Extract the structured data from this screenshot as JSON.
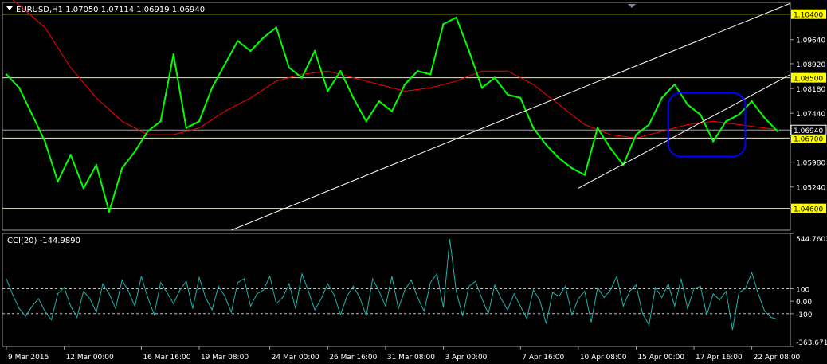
{
  "header": {
    "symbol_line": "EURUSD,H1  1.07050 1.07114 1.06919 1.06940",
    "indicator_line": "CCI(20) -144.9890"
  },
  "colors": {
    "background": "#000000",
    "price_line": "#00ff00",
    "moving_average": "#ff0000",
    "level_line": "#ffff00",
    "channel_line": "#ffffff",
    "current_price": "#a0a0a0",
    "highlight_box": "#0000ff",
    "cci_line": "#20b2aa",
    "axis_text": "#ffffff"
  },
  "chart_data": [
    {
      "type": "line",
      "symbol": "EURUSD",
      "timeframe": "H1",
      "ohlc_readout": {
        "open": 1.0705,
        "high": 1.07114,
        "low": 1.06919,
        "close": 1.0694
      },
      "ylim": [
        1.0395,
        1.1075
      ],
      "y_tick_labels": [
        "1.09640",
        "1.08920",
        "1.08180",
        "1.07440",
        "1.05980",
        "1.05240"
      ],
      "y_ticks": [
        1.0964,
        1.0892,
        1.0818,
        1.0744,
        1.0598,
        1.0524
      ],
      "x_tick_labels": [
        "9 Mar 2015",
        "12 Mar 00:00",
        "16 Mar 16:00",
        "19 Mar 08:00",
        "24 Mar 00:00",
        "26 Mar 16:00",
        "31 Mar 08:00",
        "3 Apr 00:00",
        "7 Apr 16:00",
        "10 Apr 08:00",
        "15 Apr 00:00",
        "17 Apr 16:00",
        "22 Apr 08:00"
      ],
      "x_ticks": [
        0,
        9,
        21,
        30,
        41,
        50,
        59,
        68,
        80,
        89,
        98,
        107,
        116
      ],
      "series": [
        {
          "role": "price",
          "x": [
            0,
            2,
            4,
            6,
            8,
            10,
            12,
            14,
            16,
            18,
            20,
            22,
            24,
            26,
            28,
            30,
            32,
            34,
            36,
            38,
            40,
            42,
            44,
            46,
            48,
            50,
            52,
            54,
            56,
            58,
            60,
            62,
            64,
            66,
            68,
            70,
            72,
            74,
            76,
            78,
            80,
            82,
            84,
            86,
            88,
            90,
            92,
            94,
            96,
            98,
            100,
            102,
            104,
            106,
            108,
            110,
            112,
            114,
            116,
            118,
            120
          ],
          "values": [
            1.086,
            1.082,
            1.074,
            1.066,
            1.054,
            1.062,
            1.052,
            1.059,
            1.045,
            1.058,
            1.063,
            1.069,
            1.072,
            1.092,
            1.07,
            1.072,
            1.082,
            1.089,
            1.096,
            1.093,
            1.097,
            1.1,
            1.088,
            1.085,
            1.093,
            1.081,
            1.087,
            1.079,
            1.072,
            1.078,
            1.075,
            1.083,
            1.087,
            1.086,
            1.101,
            1.103,
            1.093,
            1.082,
            1.085,
            1.08,
            1.079,
            1.07,
            1.065,
            1.061,
            1.058,
            1.056,
            1.07,
            1.064,
            1.059,
            1.068,
            1.071,
            1.079,
            1.083,
            1.077,
            1.074,
            1.066,
            1.072,
            1.074,
            1.078,
            1.073,
            1.069
          ]
        },
        {
          "role": "moving-average",
          "x": [
            0,
            6,
            10,
            14,
            18,
            22,
            26,
            30,
            34,
            38,
            42,
            46,
            50,
            54,
            58,
            62,
            66,
            70,
            74,
            78,
            82,
            86,
            90,
            94,
            98,
            102,
            106,
            110,
            114,
            118,
            120
          ],
          "values": [
            1.11,
            1.1,
            1.088,
            1.079,
            1.072,
            1.068,
            1.068,
            1.07,
            1.075,
            1.079,
            1.084,
            1.086,
            1.087,
            1.085,
            1.083,
            1.081,
            1.082,
            1.084,
            1.087,
            1.087,
            1.083,
            1.077,
            1.071,
            1.068,
            1.067,
            1.069,
            1.071,
            1.072,
            1.071,
            1.07,
            1.0695
          ]
        }
      ],
      "levels": [
        {
          "label": "1.10400",
          "value": 1.104
        },
        {
          "label": "1.08500",
          "value": 1.085
        },
        {
          "label": "1.06700",
          "value": 1.067
        },
        {
          "label": "1.04600",
          "value": 1.046
        }
      ],
      "current_price": {
        "label": "1.06940",
        "value": 1.0694
      },
      "channel": {
        "upper": [
          [
            35,
            1.0395
          ],
          [
            123,
            1.108
          ]
        ],
        "lower": [
          [
            89,
            1.052
          ],
          [
            123,
            1.087
          ]
        ]
      },
      "highlight": {
        "x": [
          103,
          115
        ],
        "y": [
          1.0615,
          1.0805
        ]
      },
      "grid": false
    },
    {
      "type": "line",
      "indicator": "CCI",
      "period": 20,
      "last_value": -144.989,
      "ylim": [
        -363.6717,
        544.7602
      ],
      "y_tick_labels": [
        "544.7602",
        "100",
        "0.00",
        "-100",
        "-363.6717"
      ],
      "y_ticks": [
        544.7602,
        100,
        0,
        -100,
        -363.6717
      ],
      "reference_lines": [
        100,
        -100
      ],
      "series": [
        {
          "x": [
            0,
            1,
            2,
            3,
            4,
            5,
            6,
            7,
            8,
            9,
            10,
            11,
            12,
            13,
            14,
            15,
            16,
            17,
            18,
            19,
            20,
            21,
            22,
            23,
            24,
            25,
            26,
            27,
            28,
            29,
            30,
            31,
            32,
            33,
            34,
            35,
            36,
            37,
            38,
            39,
            40,
            41,
            42,
            43,
            44,
            45,
            46,
            47,
            48,
            49,
            50,
            51,
            52,
            53,
            54,
            55,
            56,
            57,
            58,
            59,
            60,
            61,
            62,
            63,
            64,
            65,
            66,
            67,
            68,
            69,
            70,
            71,
            72,
            73,
            74,
            75,
            76,
            77,
            78,
            79,
            80,
            81,
            82,
            83,
            84,
            85,
            86,
            87,
            88,
            89,
            90,
            91,
            92,
            93,
            94,
            95,
            96,
            97,
            98,
            99,
            100,
            101,
            102,
            103,
            104,
            105,
            106,
            107,
            108,
            109,
            110,
            111,
            112,
            113,
            114,
            115,
            116,
            117,
            118,
            119,
            120
          ],
          "values": [
            180,
            50,
            -60,
            -120,
            -40,
            20,
            -80,
            -150,
            60,
            110,
            -40,
            -130,
            80,
            20,
            -90,
            140,
            60,
            -60,
            170,
            80,
            -40,
            200,
            30,
            -110,
            150,
            70,
            -20,
            90,
            160,
            -60,
            190,
            30,
            -70,
            120,
            40,
            -90,
            150,
            180,
            -40,
            60,
            90,
            200,
            -20,
            30,
            140,
            -60,
            220,
            80,
            -70,
            20,
            140,
            50,
            -110,
            40,
            120,
            30,
            -120,
            180,
            80,
            -40,
            200,
            -60,
            90,
            170,
            30,
            -80,
            150,
            220,
            -50,
            500,
            80,
            -120,
            120,
            160,
            20,
            -100,
            130,
            20,
            -70,
            60,
            -40,
            -140,
            90,
            10,
            -180,
            70,
            40,
            120,
            -110,
            20,
            80,
            -170,
            110,
            30,
            90,
            200,
            -40,
            80,
            130,
            -100,
            -190,
            110,
            30,
            140,
            -40,
            180,
            -60,
            100,
            120,
            -110,
            60,
            10,
            80,
            -230,
            70,
            100,
            230,
            60,
            -80,
            -130,
            -145
          ]
        }
      ]
    }
  ]
}
